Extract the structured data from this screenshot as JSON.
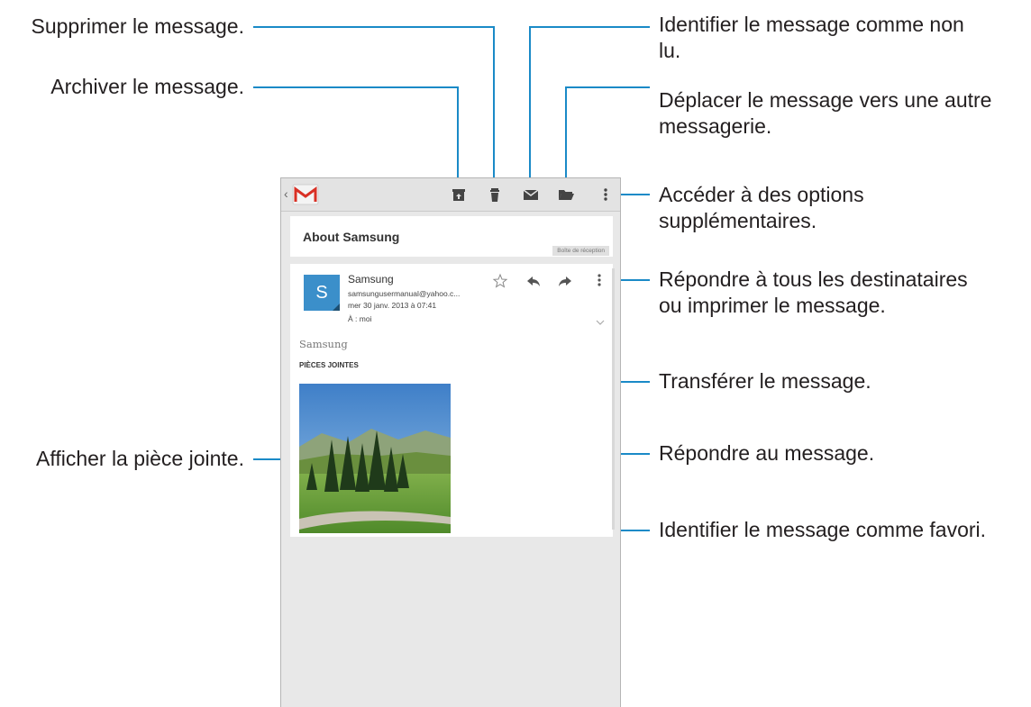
{
  "callouts": {
    "delete": "Supprimer le message.",
    "archive": "Archiver le message.",
    "mark_unread_line1": "Identifier le message comme non",
    "mark_unread_line2": "lu.",
    "move_line1": "Déplacer le message vers une autre",
    "move_line2": "messagerie.",
    "more_options_line1": "Accéder à des options",
    "more_options_line2": "supplémentaires.",
    "reply_all_line1": "Répondre à tous les destinataires",
    "reply_all_line2": "ou imprimer le message.",
    "forward": "Transférer le message.",
    "reply": "Répondre au message.",
    "view_attachment": "Afficher la pièce jointe.",
    "favorite": "Identifier le message comme favori."
  },
  "email": {
    "subject": "About Samsung",
    "folder_label": "Boîte de réception",
    "avatar_letter": "S",
    "sender_name": "Samsung",
    "sender_email": "samsungusermanual@yahoo.c...",
    "date": "mer 30 janv. 2013 à 07:41",
    "to": "À : moi",
    "body": "Samsung",
    "attachments_title": "PIÈCES JOINTES"
  },
  "colors": {
    "leader_line": "#1a8ac7",
    "avatar": "#3b8fca",
    "gmail_red": "#d93025"
  },
  "icons": [
    "back-chevron-icon",
    "gmail-icon",
    "archive-icon",
    "trash-icon",
    "envelope-icon",
    "folder-icon",
    "overflow-menu-icon",
    "star-icon",
    "reply-icon",
    "forward-icon",
    "expand-chevron-icon"
  ]
}
